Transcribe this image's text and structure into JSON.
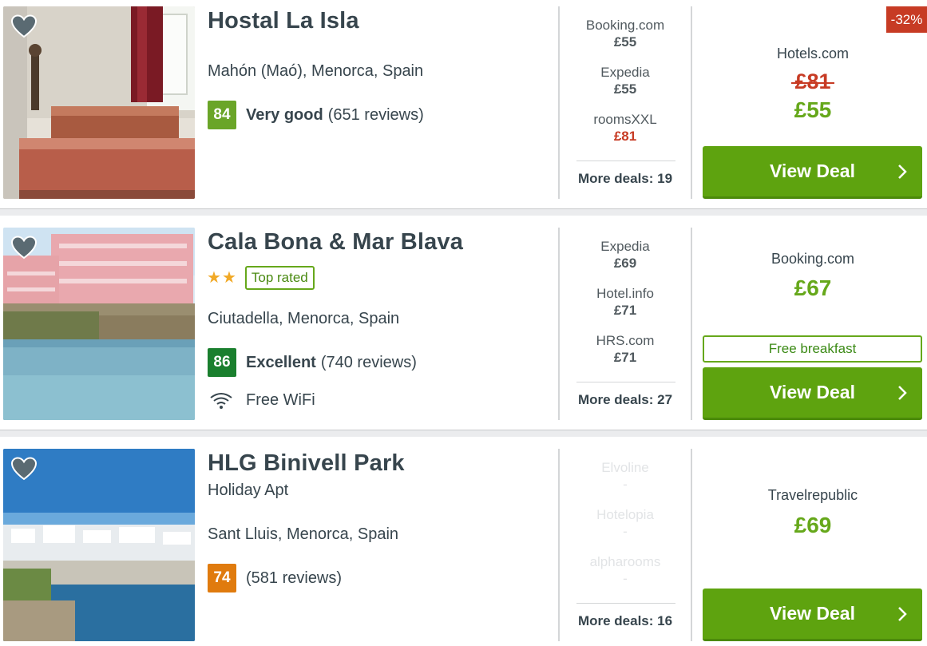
{
  "listings": [
    {
      "name": "Hostal La Isla",
      "location": "Mahón (Maó), Menorca, Spain",
      "score": "84",
      "score_color": "#6aa528",
      "rating_word": "Very good",
      "reviews": "(651 reviews)",
      "deals": [
        {
          "provider": "Booking.com",
          "price": "£55"
        },
        {
          "provider": "Expedia",
          "price": "£55"
        },
        {
          "provider": "roomsXXL",
          "price": "£81"
        }
      ],
      "more_deals": "More deals: 19",
      "discount": "-32%",
      "main_provider": "Hotels.com",
      "old_price": "£81",
      "price": "£55",
      "cta": "View Deal"
    },
    {
      "name": "Cala Bona & Mar Blava",
      "stars": 2,
      "badge": "Top rated",
      "location": "Ciutadella, Menorca, Spain",
      "score": "86",
      "score_color": "#1a7f2e",
      "rating_word": "Excellent",
      "reviews": "(740 reviews)",
      "amenity": "Free WiFi",
      "amenity_icon": "wifi-icon",
      "deals": [
        {
          "provider": "Expedia",
          "price": "£69"
        },
        {
          "provider": "Hotel.info",
          "price": "£71"
        },
        {
          "provider": "HRS.com",
          "price": "£71"
        }
      ],
      "more_deals": "More deals: 27",
      "main_provider": "Booking.com",
      "price": "£67",
      "perk": "Free breakfast",
      "cta": "View Deal"
    },
    {
      "name": "HLG Binivell Park",
      "subtitle": "Holiday Apt",
      "location": "Sant Lluis, Menorca, Spain",
      "score": "74",
      "score_color": "#e07b0e",
      "reviews": "(581 reviews)",
      "deals": [
        {
          "provider": "Elvoline",
          "price": "-"
        },
        {
          "provider": "Hotelopia",
          "price": "-"
        },
        {
          "provider": "alpharooms",
          "price": "-"
        }
      ],
      "more_deals": "More deals: 16",
      "main_provider": "Travelrepublic",
      "price": "£69",
      "cta": "View Deal"
    }
  ],
  "colors": {
    "green_price": "#66a81b",
    "button_green": "#5ea30f",
    "red": "#c73b24",
    "text": "#37454d"
  },
  "icons": [
    "heart-icon",
    "chevron-right-icon",
    "wifi-icon",
    "star-icon"
  ]
}
